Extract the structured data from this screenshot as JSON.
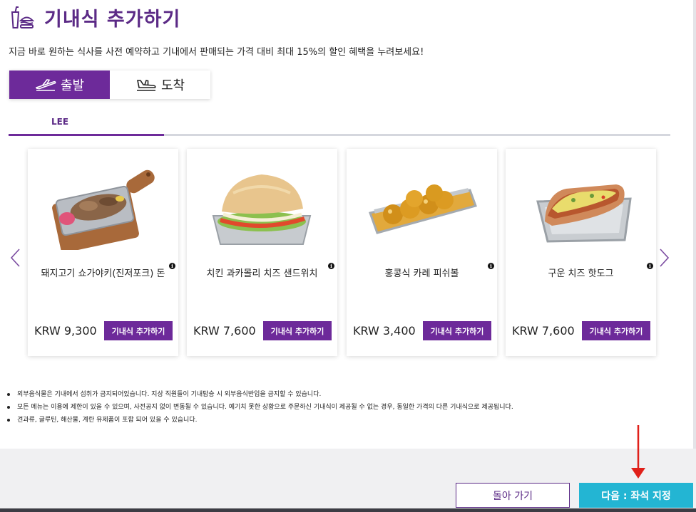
{
  "header": {
    "title": "기내식 추가하기",
    "icon": "meal-cup-burger-icon",
    "subtitle": "지금 바로 원하는 식사를 사전 예약하고 기내에서 판매되는 가격 대비 최대 15%의 할인 혜택을 누려보세요!"
  },
  "segment": {
    "departure": {
      "label": "출발",
      "icon": "departure-plane-icon"
    },
    "arrival": {
      "label": "도착",
      "icon": "arrival-plane-icon"
    }
  },
  "passenger_tab": {
    "label": "LEE"
  },
  "colors": {
    "brand": "#6d2a9a",
    "title": "#5b2a86",
    "next": "#23b5d3",
    "arrow_red": "#e0201a"
  },
  "meals": [
    {
      "name": "돼지고기 쇼가야키(진저포크) 돈",
      "price": "KRW 9,300",
      "button": "기내식 추가하기",
      "image": "pork-rice-tray"
    },
    {
      "name": "치킨 과카몰리 치즈 샌드위치",
      "price": "KRW 7,600",
      "button": "기내식 추가하기",
      "image": "chicken-sandwich"
    },
    {
      "name": "홍콩식 카레 피쉬볼",
      "price": "KRW 3,400",
      "button": "기내식 추가하기",
      "image": "curry-fishball"
    },
    {
      "name": "구운 치즈 핫도그",
      "price": "KRW 7,600",
      "button": "기내식 추가하기",
      "image": "cheese-hotdog"
    }
  ],
  "notes": [
    "외부음식물은 기내에서 섭취가 금지되어있습니다. 지상 직원들이 기내탑승 시 외부음식반입을 금지할 수 있습니다.",
    "모든 메뉴는 이용에 제한이 있을 수 있으며, 사전공지 없이 변동될 수 있습니다. 예기치 못한 상황으로 주문하신 기내식이 제공될 수 없는 경우, 동일한 가격의 다른 기내식으로 제공됩니다.",
    "견과류, 글루틴, 해산물, 계란 유제품이 포함 되어 있을 수 있습니다."
  ],
  "footer": {
    "back": "돌아 가기",
    "next": "다음 : 좌석 지정"
  }
}
